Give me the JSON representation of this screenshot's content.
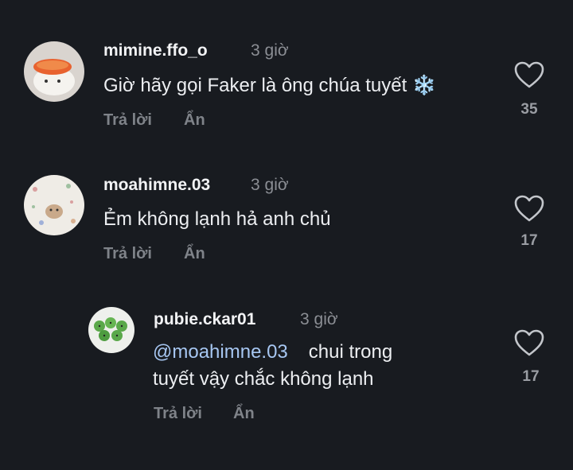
{
  "comments": [
    {
      "username": "mimine.ffo_o",
      "time": "3 giờ",
      "text": "Giờ hãy gọi Faker là ông chúa tuyết",
      "emoji": "❄️",
      "reply_label": "Trả lời",
      "hide_label": "Ẩn",
      "likes": "35"
    },
    {
      "username": "moahimne.03",
      "time": "3 giờ",
      "text": "Ẻm không lạnh hả anh chủ",
      "reply_label": "Trả lời",
      "hide_label": "Ẩn",
      "likes": "17"
    },
    {
      "username": "pubie.ckar01",
      "time": "3 giờ",
      "mention": "@moahimne.03",
      "text_line1": "chui trong",
      "text_line2": "tuyết vậy chắc không lạnh",
      "reply_label": "Trả lời",
      "hide_label": "Ẩn",
      "likes": "17"
    }
  ],
  "icons": {
    "like": "heart-outline-icon",
    "emoji": "snowflake-icon"
  },
  "colors": {
    "background": "#181b20",
    "mention": "#a7c7f2",
    "muted": "#7f8389"
  }
}
